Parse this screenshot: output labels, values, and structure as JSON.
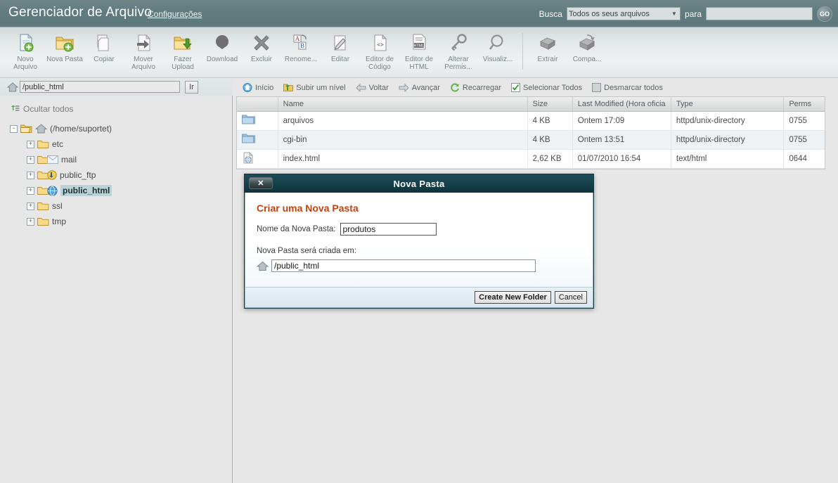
{
  "header": {
    "app_title": "Gerenciador de Arquivo",
    "settings_label": "Configurações",
    "search_label": "Busca",
    "search_scope_value": "Todos os seus arquivos",
    "search_for_label": "para",
    "search_input_value": "",
    "search_input_placeholder": "",
    "go_label": "GO",
    "bar_color": "#607b7e"
  },
  "toolbar": {
    "items": [
      {
        "label": "Novo Arquivo",
        "icon": "new-file-icon"
      },
      {
        "label": "Nova Pasta",
        "icon": "new-folder-icon"
      },
      {
        "label": "Copiar",
        "icon": "copy-icon"
      },
      {
        "label": "Mover Arquivo",
        "icon": "move-file-icon"
      },
      {
        "label": "Fazer Upload",
        "icon": "upload-icon"
      },
      {
        "label": "Download",
        "icon": "download-icon"
      },
      {
        "label": "Excluir",
        "icon": "delete-icon"
      },
      {
        "label": "Renome...",
        "icon": "rename-icon"
      },
      {
        "label": "Editar",
        "icon": "edit-icon"
      },
      {
        "label": "Editor de Código",
        "icon": "code-editor-icon"
      },
      {
        "label": "Editor de HTML",
        "icon": "html-editor-icon"
      },
      {
        "label": "Alterar Permis...",
        "icon": "permissions-key-icon"
      },
      {
        "label": "Visualiz...",
        "icon": "view-magnifier-icon"
      },
      {
        "label": "Extrair",
        "icon": "extract-icon"
      },
      {
        "label": "Compa...",
        "icon": "compress-icon"
      }
    ]
  },
  "sidebar": {
    "path_value": "/public_html",
    "go_button_label": "Ir",
    "hide_all_label": "Ocultar todos",
    "root": {
      "label": "(/home/suportet)",
      "expander": "-"
    },
    "tree_items": [
      {
        "label": "etc",
        "expander": "+",
        "icon": "folder-icon",
        "selected": false
      },
      {
        "label": "mail",
        "expander": "+",
        "icon": "mail-folder-icon",
        "selected": false
      },
      {
        "label": "public_ftp",
        "expander": "+",
        "icon": "ftp-folder-icon",
        "selected": false
      },
      {
        "label": "public_html",
        "expander": "+",
        "icon": "web-folder-icon",
        "selected": true
      },
      {
        "label": "ssl",
        "expander": "+",
        "icon": "folder-icon",
        "selected": false
      },
      {
        "label": "tmp",
        "expander": "+",
        "icon": "folder-icon",
        "selected": false
      }
    ]
  },
  "navbar": {
    "items": [
      {
        "label": "Início",
        "icon": "home-icon"
      },
      {
        "label": "Subir um nível",
        "icon": "up-level-icon"
      },
      {
        "label": "Voltar",
        "icon": "back-arrow-icon"
      },
      {
        "label": "Avançar",
        "icon": "forward-arrow-icon"
      },
      {
        "label": "Recarregar",
        "icon": "reload-icon"
      },
      {
        "label": "Selecionar Todos",
        "icon": "checked-box-icon"
      },
      {
        "label": "Desmarcar todos",
        "icon": "unchecked-box-icon"
      }
    ]
  },
  "filetable": {
    "columns": [
      "",
      "Name",
      "Size",
      "Last Modified (Hora oficia",
      "Type",
      "Perms"
    ],
    "rows": [
      {
        "icon": "folder-icon",
        "name": "arquivos",
        "size": "4 KB",
        "modified": "Ontem 17:09",
        "type": "httpd/unix-directory",
        "perms": "0755"
      },
      {
        "icon": "folder-icon",
        "name": "cgi-bin",
        "size": "4 KB",
        "modified": "Ontem 13:51",
        "type": "httpd/unix-directory",
        "perms": "0755"
      },
      {
        "icon": "html-file-icon",
        "name": "index.html",
        "size": "2,62 KB",
        "modified": "01/07/2010 16:54",
        "type": "text/html",
        "perms": "0644"
      }
    ]
  },
  "modal": {
    "title": "Nova Pasta",
    "close_label": "✕",
    "heading": "Criar uma Nova Pasta",
    "name_label": "Nome da Nova Pasta:",
    "name_value": "produtos",
    "dest_label": "Nova Pasta será criada em:",
    "dest_value": "/public_html",
    "create_button": "Create New Folder",
    "cancel_button": "Cancel",
    "heading_color": "#c1440e",
    "titlebar_color": "#16424c"
  }
}
